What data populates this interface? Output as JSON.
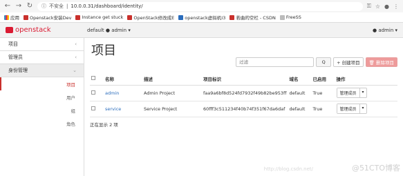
{
  "browser": {
    "security_label": "不安全",
    "url": "10.0.0.31/dashboard/identity/",
    "bookmarks": [
      {
        "label": "应用",
        "icon": "grid"
      },
      {
        "label": "Openstack安装Dev",
        "icon": "red"
      },
      {
        "label": "Instance get stuck",
        "icon": "red"
      },
      {
        "label": "OpenStack修改成E",
        "icon": "red"
      },
      {
        "label": "openstack虚拟机I3",
        "icon": "blue"
      },
      {
        "label": "若曲的空栏 - CSDN",
        "icon": "red"
      },
      {
        "label": "FreeSS",
        "icon": "gray"
      }
    ]
  },
  "header": {
    "brand": "openstack",
    "project_selector": "default ● admin ▾",
    "user_menu": "● admin ▾"
  },
  "sidebar": {
    "sections": [
      {
        "label": "项目",
        "chevron": "‹"
      },
      {
        "label": "管理员",
        "chevron": "‹"
      },
      {
        "label": "身份管理",
        "chevron": "⌄"
      }
    ],
    "items": [
      {
        "label": "项目"
      },
      {
        "label": "用户"
      },
      {
        "label": "组"
      },
      {
        "label": "角色"
      }
    ]
  },
  "main": {
    "title": "项目",
    "filter_placeholder": "过滤",
    "filter_button": "Q",
    "create_button": "+ 创建项目",
    "delete_button": "🗑 删除项目",
    "columns": [
      "",
      "名称",
      "描述",
      "项目标识",
      "域名",
      "已启用",
      "操作"
    ],
    "rows": [
      {
        "name": "admin",
        "description": "Admin Project",
        "id": "faa9a6bf8d524fd7932f49b82be953ff",
        "domain": "default",
        "enabled": "True",
        "action": "管理成员"
      },
      {
        "name": "service",
        "description": "Service Project",
        "id": "60fff3c511234f40b74f351f67da6daf",
        "domain": "default",
        "enabled": "True",
        "action": "管理成员"
      }
    ],
    "count_text": "正在显示 2 项"
  },
  "watermark": {
    "url": "http://blog.csdn.net/",
    "brand": "@51CTO博客"
  }
}
